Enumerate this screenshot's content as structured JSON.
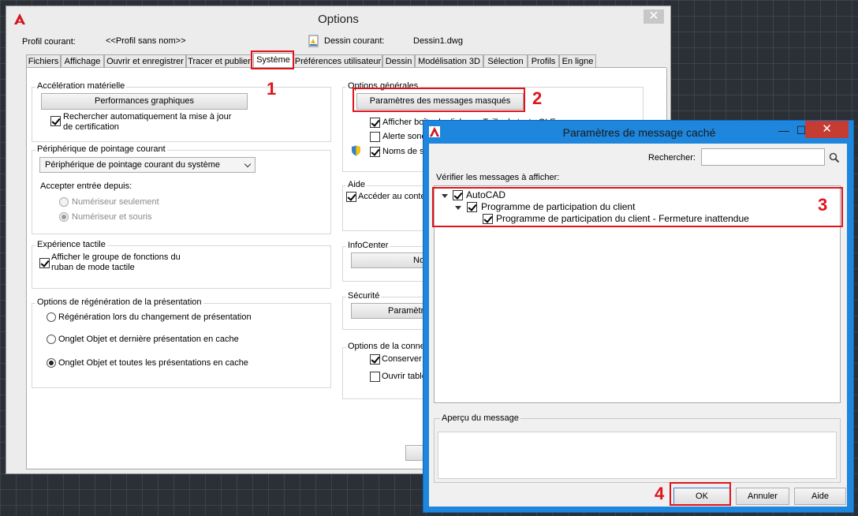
{
  "options": {
    "title": "Options",
    "profile_label": "Profil courant:",
    "profile_value": "<<Profil sans nom>>",
    "drawing_label": "Dessin courant:",
    "drawing_value": "Dessin1.dwg",
    "close_glyph": "✕",
    "tabs": [
      "Fichiers",
      "Affichage",
      "Ouvrir et enregistrer",
      "Tracer et publier",
      "Système",
      "Préférences utilisateur",
      "Dessin",
      "Modélisation 3D",
      "Sélection",
      "Profils",
      "En ligne"
    ],
    "active_tab": "Système"
  },
  "hardware": {
    "title": "Accélération matérielle",
    "button": "Performances graphiques",
    "check_line1": "Rechercher automatiquement la mise à jour",
    "check_line2": "de certification"
  },
  "pointing": {
    "title": "Périphérique de pointage courant",
    "select_value": "Périphérique de pointage courant du système",
    "accept_label": "Accepter entrée depuis:",
    "radio1": "Numériseur seulement",
    "radio2": "Numériseur et souris"
  },
  "touch": {
    "title": "Expérience tactile",
    "check_line1": "Afficher le groupe de fonctions du",
    "check_line2": "ruban de mode tactile"
  },
  "regen": {
    "title": "Options de régénération de la présentation",
    "radio1": "Régénération lors du changement de présentation",
    "radio2": "Onglet Objet et dernière présentation en cache",
    "radio3": "Onglet Objet et toutes les présentations en cache"
  },
  "general": {
    "title": "Options générales",
    "hidden_messages_button": "Paramètres des messages masqués",
    "check1": "Afficher boîte de dialogue Taille du texte OLE",
    "check2": "Alerte sonore",
    "check3": "Noms de s"
  },
  "help": {
    "title": "Aide",
    "check": "Accéder au conte"
  },
  "infocenter": {
    "title": "InfoCenter",
    "button": "No"
  },
  "security": {
    "title": "Sécurité",
    "button": "Paramètre"
  },
  "connection": {
    "title": "Options de la conne",
    "check1": "Conserver",
    "check2": "Ouvrir table"
  },
  "dialog": {
    "title": "Paramètres de message caché",
    "minimize": "—",
    "maximize": "☐",
    "close": "✕",
    "search_label": "Rechercher:",
    "search_value": "",
    "verify_label": "Vérifier les messages à afficher:",
    "tree": {
      "root": "AutoCAD",
      "child": "Programme de participation du client",
      "leaf": "Programme de participation du client - Fermeture inattendue"
    },
    "preview_label": "Aperçu du message",
    "ok": "OK",
    "cancel": "Annuler",
    "help": "Aide"
  },
  "annotations": [
    "1",
    "2",
    "3",
    "4"
  ],
  "colors": {
    "highlight_red": "#e0141b",
    "dialog_frame": "#1e86dc",
    "close_red": "#c43c32"
  }
}
